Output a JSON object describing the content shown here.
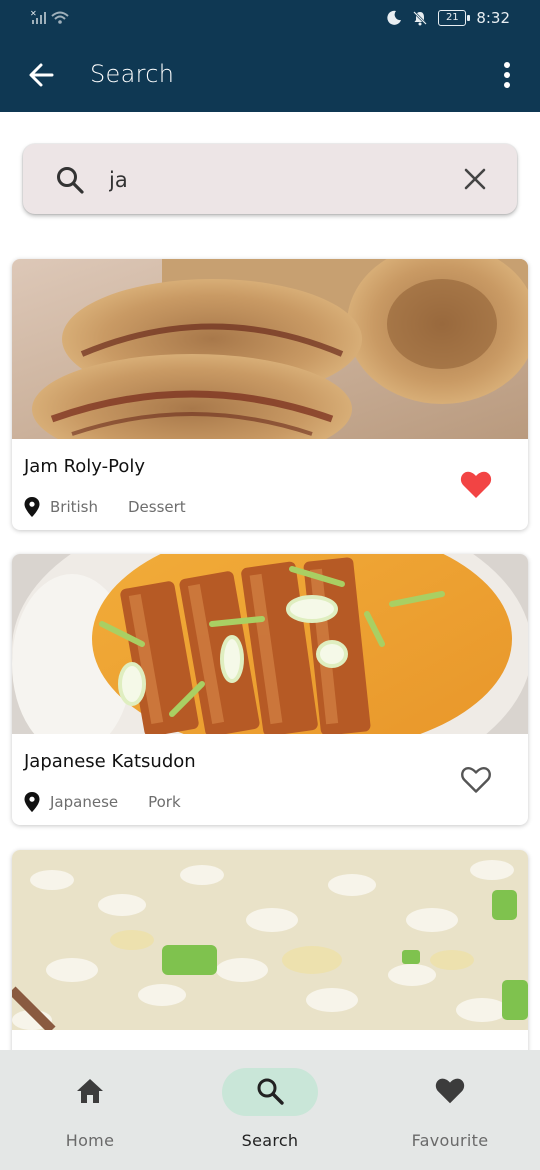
{
  "status_bar": {
    "signal_text": "✕││",
    "battery": "21",
    "time": "8:32"
  },
  "app_bar": {
    "title": "Search"
  },
  "search": {
    "value": "ja",
    "placeholder": ""
  },
  "results": [
    {
      "title": "Jam Roly-Poly",
      "area": "British",
      "category": "Dessert",
      "favourite": true
    },
    {
      "title": "Japanese Katsudon",
      "area": "Japanese",
      "category": "Pork",
      "favourite": false
    },
    {
      "title": "",
      "area": "",
      "category": "",
      "favourite": false
    }
  ],
  "bottom_nav": {
    "items": [
      {
        "label": "Home",
        "icon": "home-icon",
        "active": false
      },
      {
        "label": "Search",
        "icon": "search-icon",
        "active": true
      },
      {
        "label": "Favourite",
        "icon": "heart-icon",
        "active": false
      }
    ]
  },
  "colors": {
    "primary": "#0f3853",
    "favourite_red": "#f24444",
    "nav_active_pill": "#c9e6d8"
  }
}
